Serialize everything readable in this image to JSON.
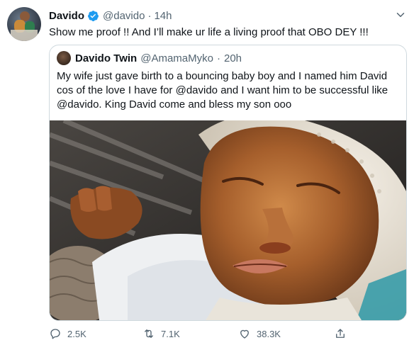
{
  "tweet": {
    "author_name": "Davido",
    "author_handle": "@davido",
    "separator": "·",
    "time": "14h",
    "text": "Show me proof !! And I’ll make ur life a living proof that OBO DEY !!!",
    "verified_color": "#1d9bf0"
  },
  "quote": {
    "author_name": "Davido Twin",
    "author_handle": "@AmamaMyko",
    "separator": "·",
    "time": "20h",
    "lines": [
      "My wife just gave birth to a bouncing baby boy and I named him David",
      "cos of the love I have for @davido and I want him to be successful like",
      "@davido. King David come and bless my son ooo"
    ]
  },
  "actions": {
    "reply_count": "2.5K",
    "retweet_count": "7.1K",
    "like_count": "38.3K"
  },
  "icons": [
    "verified-badge-icon",
    "chevron-down-icon",
    "reply-icon",
    "retweet-icon",
    "like-icon",
    "share-icon"
  ]
}
